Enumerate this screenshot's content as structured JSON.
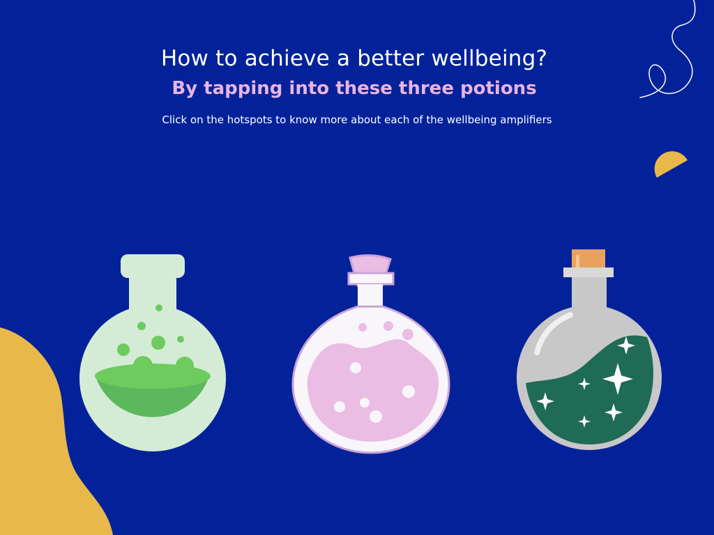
{
  "title": "How to achieve a better wellbeing?",
  "subtitle": "By tapping into these three potions",
  "instruction": "Click on the hotspots to know more about each of the wellbeing amplifiers",
  "colors": {
    "background": "#03229A",
    "subtitle": "#E8B4E3",
    "accent_yellow": "#E8B84A",
    "green_liquid": "#5CB85C",
    "green_glass": "#D4ECD6",
    "pink_liquid": "#EBBCE4",
    "pink_glass": "#F8F6FA",
    "teal_liquid": "#1F6B55",
    "grey_glass": "#C8C8C8",
    "cork": "#E8A25E"
  },
  "potions": [
    {
      "icon": "green-bubbling-potion-icon"
    },
    {
      "icon": "pink-potion-bottle-icon"
    },
    {
      "icon": "sparkling-green-potion-icon"
    }
  ],
  "decorations": [
    "squiggle-line-icon",
    "yellow-half-circle-icon",
    "yellow-blob-icon"
  ]
}
